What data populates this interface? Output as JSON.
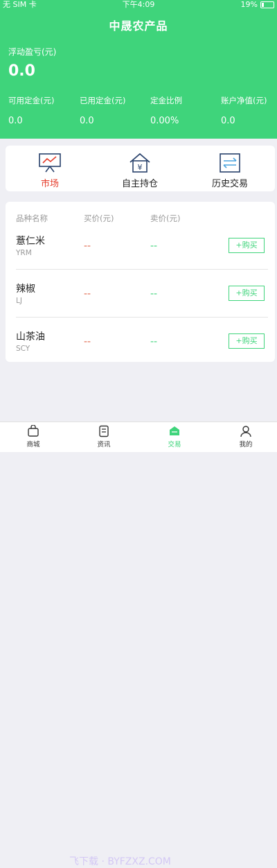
{
  "status": {
    "carrier": "无 SIM 卡",
    "time": "下午4:09",
    "battery": "19%"
  },
  "header": {
    "title": "中晟农产品"
  },
  "float": {
    "label": "浮动盈亏(元)",
    "value": "0.0"
  },
  "stats": [
    {
      "label": "可用定金(元)",
      "value": "0.0"
    },
    {
      "label": "已用定金(元)",
      "value": "0.0"
    },
    {
      "label": "定金比例",
      "value": "0.00%"
    },
    {
      "label": "账户净值(元)",
      "value": "0.0"
    }
  ],
  "nav": [
    {
      "label": "市场",
      "icon": "chart-board-icon"
    },
    {
      "label": "自主持仓",
      "icon": "house-yen-icon"
    },
    {
      "label": "历史交易",
      "icon": "exchange-arrows-icon"
    }
  ],
  "list": {
    "headers": [
      "品种名称",
      "买价(元)",
      "卖价(元)"
    ],
    "rows": [
      {
        "name": "薏仁米",
        "code": "YRM",
        "buy": "--",
        "sell": "--",
        "action": "+购买"
      },
      {
        "name": "辣椒",
        "code": "LJ",
        "buy": "--",
        "sell": "--",
        "action": "+购买"
      },
      {
        "name": "山茶油",
        "code": "SCY",
        "buy": "--",
        "sell": "--",
        "action": "+购买"
      }
    ]
  },
  "tabs": [
    {
      "label": "商城",
      "icon": "shopping-bag-icon"
    },
    {
      "label": "资讯",
      "icon": "news-icon"
    },
    {
      "label": "交易",
      "icon": "trade-icon"
    },
    {
      "label": "我的",
      "icon": "user-icon"
    }
  ],
  "watermark": "飞下载 · BYFZXZ.COM",
  "colors": {
    "primary": "#3fd47b",
    "active_red": "#e53c2b",
    "buy_price": "#e06a4f"
  }
}
